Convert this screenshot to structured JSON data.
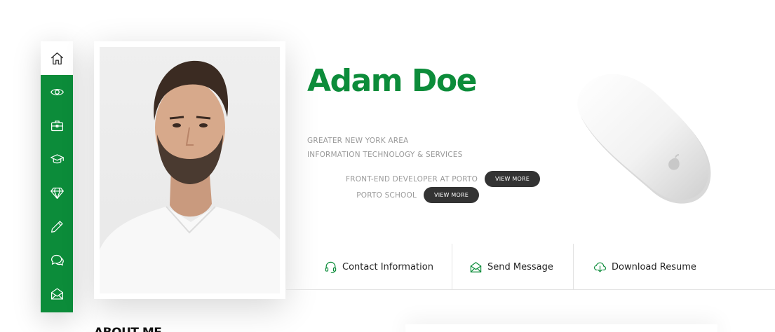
{
  "sidebar": {
    "items": [
      {
        "icon": "home-icon",
        "active": true
      },
      {
        "icon": "eye-icon"
      },
      {
        "icon": "briefcase-icon"
      },
      {
        "icon": "graduation-cap-icon"
      },
      {
        "icon": "diamond-icon"
      },
      {
        "icon": "pencil-icon"
      },
      {
        "icon": "chat-bubbles-icon"
      },
      {
        "icon": "envelope-open-icon"
      }
    ]
  },
  "profile": {
    "name": "Adam Doe",
    "location": "GREATER NEW YORK AREA",
    "industry": "INFORMATION TECHNOLOGY & SERVICES",
    "positions": [
      {
        "label": "FRONT-END DEVELOPER AT PORTO",
        "button": "VIEW MORE"
      },
      {
        "label": "PORTO SCHOOL",
        "button": "VIEW MORE"
      }
    ]
  },
  "actions": {
    "contact": "Contact Information",
    "message": "Send Message",
    "resume": "Download Resume"
  },
  "sections": {
    "about_title": "ABOUT ME"
  },
  "colors": {
    "brand": "#0c8c3a",
    "pill": "#333333"
  }
}
